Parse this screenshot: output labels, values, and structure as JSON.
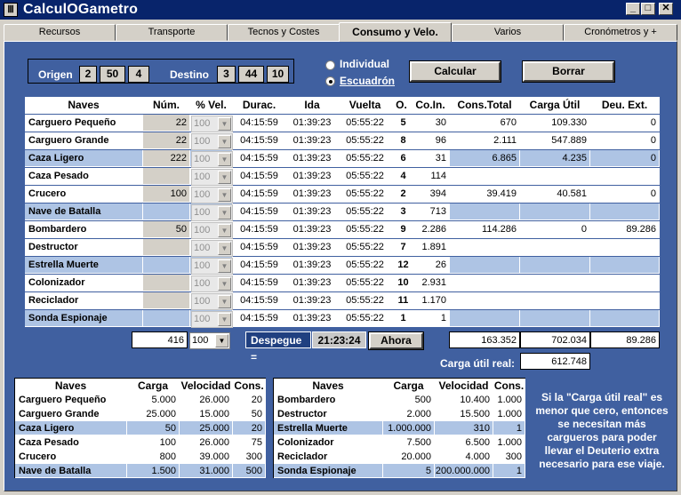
{
  "window": {
    "title": "CalculOGametro",
    "min": "_",
    "max": "□",
    "close": "✕"
  },
  "tabs": [
    "Recursos",
    "Transporte",
    "Tecnos y Costes",
    "Consumo y Velo.",
    "Varios",
    "Cronómetros y +"
  ],
  "origin": {
    "label": "Origen",
    "values": [
      "2",
      "50",
      "4"
    ]
  },
  "destination": {
    "label": "Destino",
    "values": [
      "3",
      "44",
      "10"
    ]
  },
  "mode": {
    "individual": "Individual",
    "squadron": "Escuadrón",
    "selected": "squadron"
  },
  "buttons": {
    "calc": "Calcular",
    "clear": "Borrar",
    "now": "Ahora"
  },
  "table": {
    "headers": [
      "Naves",
      "Núm.",
      "% Vel.",
      "Durac.",
      "Ida",
      "Vuelta",
      "O.",
      "Co.In.",
      "Cons.Total",
      "Carga Útil",
      "Deu. Ext."
    ],
    "rows": [
      {
        "name": "Carguero Pequeño",
        "num": "22",
        "vel": "100",
        "dur": "04:15:59",
        "ida": "01:39:23",
        "vuelta": "05:55:22",
        "o": "5",
        "coin": "30",
        "cons": "670",
        "carga": "109.330",
        "deu": "0"
      },
      {
        "name": "Carguero Grande",
        "num": "22",
        "vel": "100",
        "dur": "04:15:59",
        "ida": "01:39:23",
        "vuelta": "05:55:22",
        "o": "8",
        "coin": "96",
        "cons": "2.111",
        "carga": "547.889",
        "deu": "0"
      },
      {
        "name": "Caza  Ligero",
        "num": "222",
        "vel": "100",
        "dur": "04:15:59",
        "ida": "01:39:23",
        "vuelta": "05:55:22",
        "o": "6",
        "coin": "31",
        "cons": "6.865",
        "carga": "4.235",
        "deu": "0"
      },
      {
        "name": "Caza  Pesado",
        "num": "",
        "vel": "100",
        "dur": "04:15:59",
        "ida": "01:39:23",
        "vuelta": "05:55:22",
        "o": "4",
        "coin": "114",
        "cons": "",
        "carga": "",
        "deu": ""
      },
      {
        "name": "Crucero",
        "num": "100",
        "vel": "100",
        "dur": "04:15:59",
        "ida": "01:39:23",
        "vuelta": "05:55:22",
        "o": "2",
        "coin": "394",
        "cons": "39.419",
        "carga": "40.581",
        "deu": "0"
      },
      {
        "name": "Nave de Batalla",
        "num": "",
        "vel": "100",
        "dur": "04:15:59",
        "ida": "01:39:23",
        "vuelta": "05:55:22",
        "o": "3",
        "coin": "713",
        "cons": "",
        "carga": "",
        "deu": ""
      },
      {
        "name": "Bombardero",
        "num": "50",
        "vel": "100",
        "dur": "04:15:59",
        "ida": "01:39:23",
        "vuelta": "05:55:22",
        "o": "9",
        "coin": "2.286",
        "cons": "114.286",
        "carga": "0",
        "deu": "89.286"
      },
      {
        "name": "Destructor",
        "num": "",
        "vel": "100",
        "dur": "04:15:59",
        "ida": "01:39:23",
        "vuelta": "05:55:22",
        "o": "7",
        "coin": "1.891",
        "cons": "",
        "carga": "",
        "deu": ""
      },
      {
        "name": "Estrella Muerte",
        "num": "",
        "vel": "100",
        "dur": "04:15:59",
        "ida": "01:39:23",
        "vuelta": "05:55:22",
        "o": "12",
        "coin": "26",
        "cons": "",
        "carga": "",
        "deu": ""
      },
      {
        "name": "Colonizador",
        "num": "",
        "vel": "100",
        "dur": "04:15:59",
        "ida": "01:39:23",
        "vuelta": "05:55:22",
        "o": "10",
        "coin": "2.931",
        "cons": "",
        "carga": "",
        "deu": ""
      },
      {
        "name": "Reciclador",
        "num": "",
        "vel": "100",
        "dur": "04:15:59",
        "ida": "01:39:23",
        "vuelta": "05:55:22",
        "o": "11",
        "coin": "1.170",
        "cons": "",
        "carga": "",
        "deu": ""
      },
      {
        "name": "Sonda Espionaje",
        "num": "",
        "vel": "100",
        "dur": "04:15:59",
        "ida": "01:39:23",
        "vuelta": "05:55:22",
        "o": "1",
        "coin": "1",
        "cons": "",
        "carga": "",
        "deu": ""
      }
    ]
  },
  "totals": {
    "num": "416",
    "vel": "100",
    "takeoff_label": "Despegue =",
    "takeoff_time": "21:23:24",
    "cons": "163.352",
    "carga": "702.034",
    "deu": "89.286"
  },
  "real_load": {
    "label": "Carga útil real:",
    "value": "612.748"
  },
  "ships_left": {
    "headers": [
      "Naves",
      "Carga",
      "Velocidad",
      "Cons."
    ],
    "rows": [
      [
        "Carguero Pequeño",
        "5.000",
        "26.000",
        "20"
      ],
      [
        "Carguero Grande",
        "25.000",
        "15.000",
        "50"
      ],
      [
        "Caza  Ligero",
        "50",
        "25.000",
        "20"
      ],
      [
        "Caza  Pesado",
        "100",
        "26.000",
        "75"
      ],
      [
        "Crucero",
        "800",
        "39.000",
        "300"
      ],
      [
        "Nave de Batalla",
        "1.500",
        "31.000",
        "500"
      ]
    ]
  },
  "ships_right": {
    "headers": [
      "Naves",
      "Carga",
      "Velocidad",
      "Cons."
    ],
    "rows": [
      [
        "Bombardero",
        "500",
        "10.400",
        "1.000"
      ],
      [
        "Destructor",
        "2.000",
        "15.500",
        "1.000"
      ],
      [
        "Estrella Muerte",
        "1.000.000",
        "310",
        "1"
      ],
      [
        "Colonizador",
        "7.500",
        "6.500",
        "1.000"
      ],
      [
        "Reciclador",
        "20.000",
        "4.000",
        "300"
      ],
      [
        "Sonda Espionaje",
        "5",
        "200.000.000",
        "1"
      ]
    ]
  },
  "note": "Si la \"Carga útil real\" es menor que cero, entonces se necesitan más cargueros para poder llevar el Deuterio extra necesario para ese viaje."
}
